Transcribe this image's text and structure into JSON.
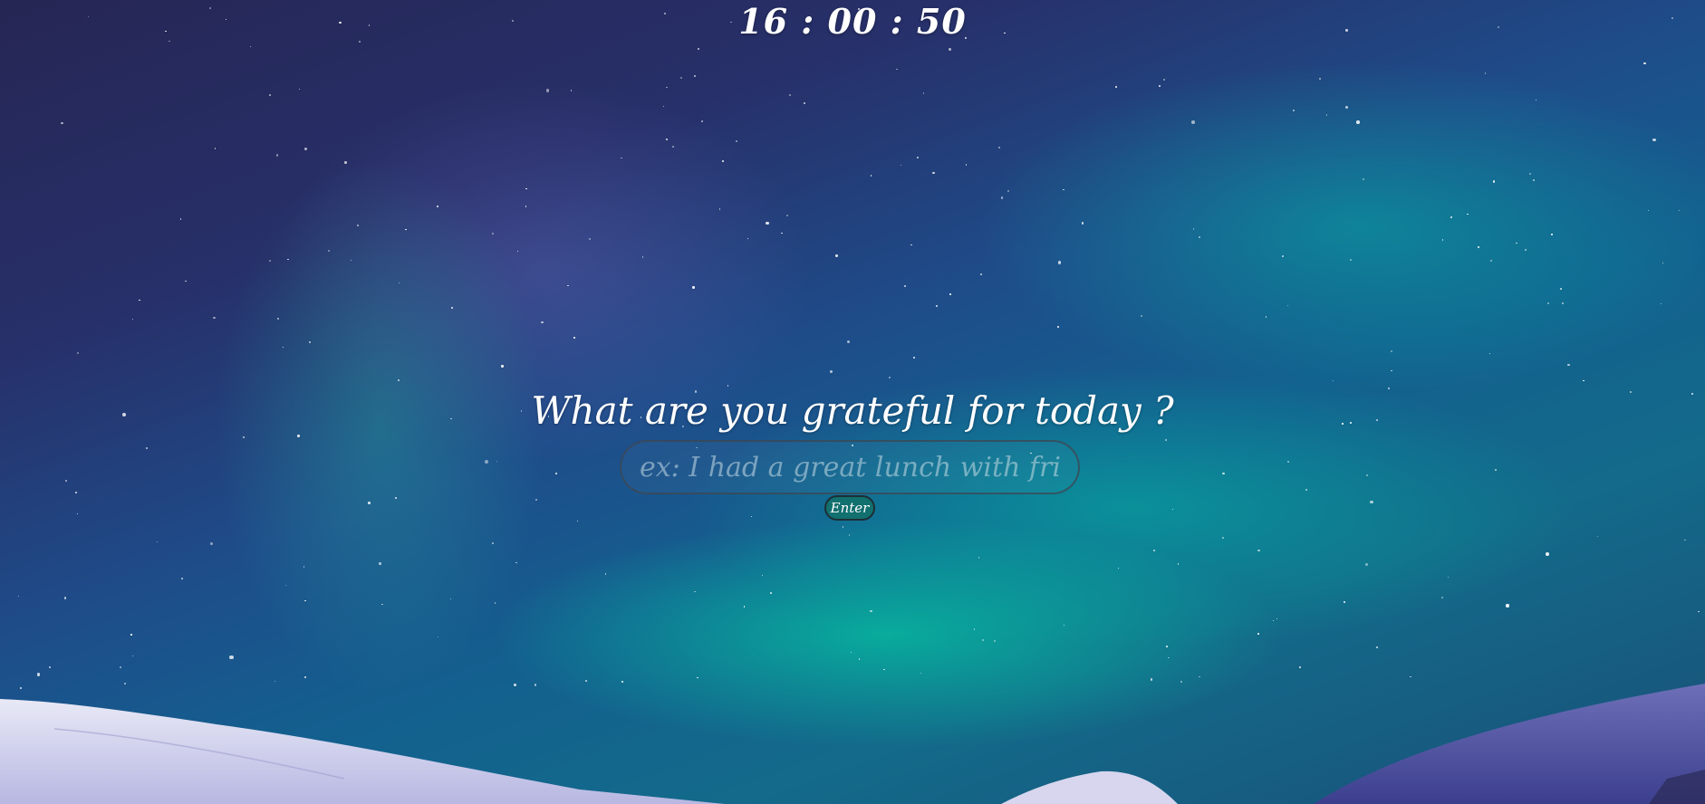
{
  "clock": {
    "time": "16 : 00 : 50"
  },
  "prompt": {
    "question": "What are you grateful for today ?"
  },
  "gratitude_form": {
    "input_value": "",
    "input_placeholder": "ex: I had a great lunch with friends",
    "submit_label": "Enter"
  }
}
